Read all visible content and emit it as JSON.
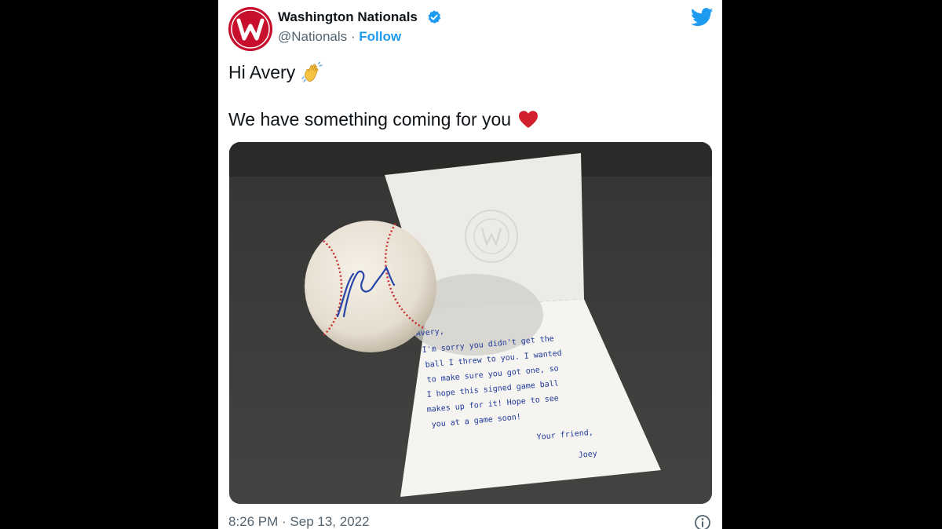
{
  "tweet": {
    "author_name": "Washington Nationals",
    "author_handle": "@Nationals",
    "separator": "·",
    "follow_label": "Follow",
    "text_line_1": "Hi Avery",
    "text_line_2": "We have something coming for you",
    "timestamp": "8:26 PM · Sep 13, 2022",
    "icons": {
      "verified": "verified-badge-icon",
      "platform": "twitter-bird-icon",
      "info": "info-icon",
      "emoji_1": "waving-hand-emoji",
      "emoji_2": "red-heart-emoji"
    },
    "colors": {
      "accent": "#1d9bf0",
      "brand_red": "#c8102e",
      "text_primary": "#0f1419",
      "text_secondary": "#536471",
      "page_background": "#000000",
      "card_background": "#ffffff"
    }
  },
  "photo": {
    "note_lines": [
      "Avery,",
      "I'm sorry you didn't get the",
      "ball I threw to you. I wanted",
      "to make sure you got one, so",
      "I hope this signed game ball",
      "makes up for it! Hope to see",
      "you at a game soon!",
      "Your friend,",
      "Joey"
    ]
  }
}
